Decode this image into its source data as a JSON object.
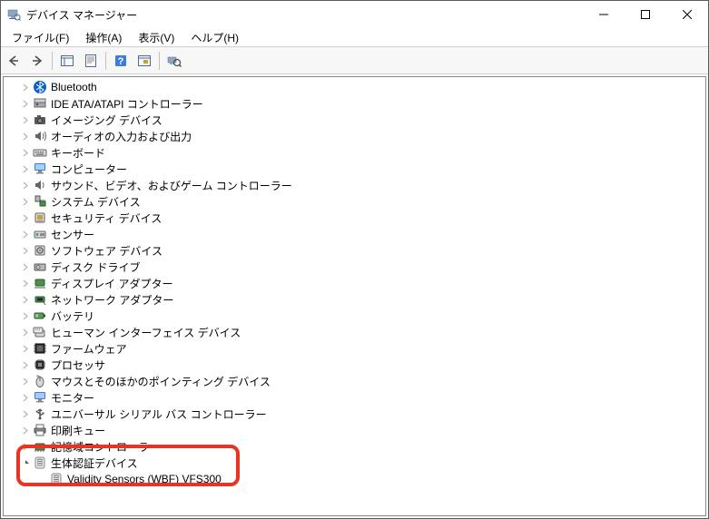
{
  "window": {
    "title": "デバイス マネージャー"
  },
  "menu": {
    "file": "ファイル(F)",
    "action": "操作(A)",
    "view": "表示(V)",
    "help": "ヘルプ(H)"
  },
  "categories": [
    {
      "label": "Bluetooth",
      "icon": "bluetooth"
    },
    {
      "label": "IDE ATA/ATAPI コントローラー",
      "icon": "ide"
    },
    {
      "label": "イメージング デバイス",
      "icon": "imaging"
    },
    {
      "label": "オーディオの入力および出力",
      "icon": "audio"
    },
    {
      "label": "キーボード",
      "icon": "keyboard"
    },
    {
      "label": "コンピューター",
      "icon": "computer"
    },
    {
      "label": "サウンド、ビデオ、およびゲーム コントローラー",
      "icon": "sound"
    },
    {
      "label": "システム デバイス",
      "icon": "system"
    },
    {
      "label": "セキュリティ デバイス",
      "icon": "security"
    },
    {
      "label": "センサー",
      "icon": "sensor"
    },
    {
      "label": "ソフトウェア デバイス",
      "icon": "software"
    },
    {
      "label": "ディスク ドライブ",
      "icon": "disk"
    },
    {
      "label": "ディスプレイ アダプター",
      "icon": "display"
    },
    {
      "label": "ネットワーク アダプター",
      "icon": "network"
    },
    {
      "label": "バッテリ",
      "icon": "battery"
    },
    {
      "label": "ヒューマン インターフェイス デバイス",
      "icon": "hid"
    },
    {
      "label": "ファームウェア",
      "icon": "firmware"
    },
    {
      "label": "プロセッサ",
      "icon": "processor"
    },
    {
      "label": "マウスとそのほかのポインティング デバイス",
      "icon": "mouse"
    },
    {
      "label": "モニター",
      "icon": "monitor"
    },
    {
      "label": "ユニバーサル シリアル バス コントローラー",
      "icon": "usb"
    },
    {
      "label": "印刷キュー",
      "icon": "print"
    },
    {
      "label": "記憶域コントローラー",
      "icon": "storage",
      "partial": true
    }
  ],
  "expanded_category": {
    "label": "生体認証デバイス",
    "icon": "biometric",
    "children": [
      {
        "label": "Validity Sensors (WBF) VFS300",
        "icon": "biometric"
      }
    ]
  }
}
